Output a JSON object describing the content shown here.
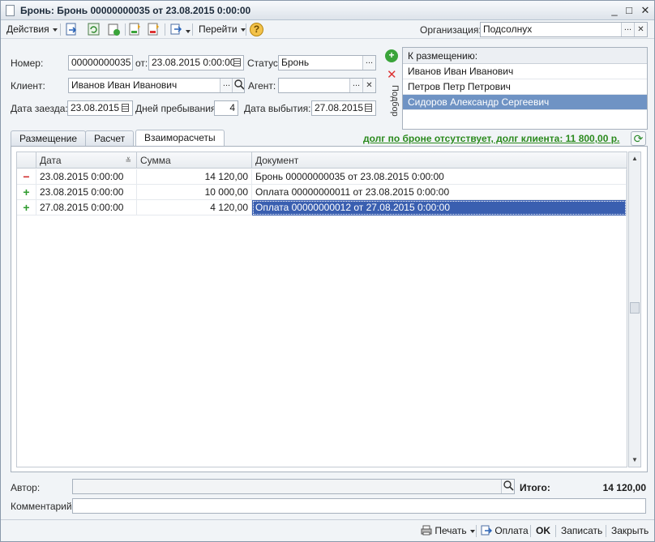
{
  "window": {
    "title": "Бронь: Бронь 00000000035 от 23.08.2015 0:00:00",
    "min_btn": "_",
    "max_btn": "□",
    "close_btn": "✕"
  },
  "toolbar": {
    "actions_label": "Действия",
    "goto_label": "Перейти",
    "org_label": "Организация:",
    "org_value": "Подсолнух",
    "help_glyph": "?"
  },
  "form": {
    "number_label": "Номер:",
    "number_value": "00000000035",
    "from_label": "от:",
    "from_value": "23.08.2015  0:00:00",
    "status_label": "Статус:",
    "status_value": "Бронь",
    "client_label": "Клиент:",
    "client_value": "Иванов Иван Иванович",
    "agent_label": "Агент:",
    "agent_value": "",
    "checkin_label": "Дата заезда:",
    "checkin_value": "23.08.2015",
    "days_label": "Дней пребывания:",
    "days_value": "4",
    "checkout_label": "Дата выбытия:",
    "checkout_value": "27.08.2015",
    "ellipsis": "...",
    "clear_glyph": "✕",
    "selection_label": "Подбор"
  },
  "placement_list": {
    "header": "К размещению:",
    "items": [
      "Иванов Иван Иванович",
      "Петров Петр Петрович",
      "Сидоров Александр Сергеевич"
    ]
  },
  "tabs": [
    "Размещение",
    "Расчет",
    "Взаиморасчеты"
  ],
  "debt_text": "долг по броне отсутствует, долг клиента: 11 800,00 р.",
  "table": {
    "columns": [
      "Дата",
      "Сумма",
      "Документ"
    ],
    "rows": [
      {
        "mark": "−",
        "date": "23.08.2015 0:00:00",
        "sum": "14 120,00",
        "doc": "Бронь 00000000035 от 23.08.2015 0:00:00"
      },
      {
        "mark": "+",
        "date": "23.08.2015 0:00:00",
        "sum": "10 000,00",
        "doc": "Оплата 00000000011 от 23.08.2015 0:00:00"
      },
      {
        "mark": "+",
        "date": "27.08.2015 0:00:00",
        "sum": "4 120,00",
        "doc": "Оплата 00000000012 от 27.08.2015 0:00:00"
      }
    ]
  },
  "footer": {
    "author_label": "Автор:",
    "total_label": "Итого:",
    "total_value": "14 120,00",
    "comment_label": "Комментарий:"
  },
  "statusbar": {
    "print_label": "Печать",
    "payment_label": "Оплата",
    "ok_label": "OK",
    "save_label": "Записать",
    "close_label": "Закрыть"
  },
  "colors": {
    "selection": "#6f93c4",
    "debt_text": "#2b8a1e",
    "minus_mark": "#d02a2a",
    "plus_mark": "#2e9b2e"
  }
}
